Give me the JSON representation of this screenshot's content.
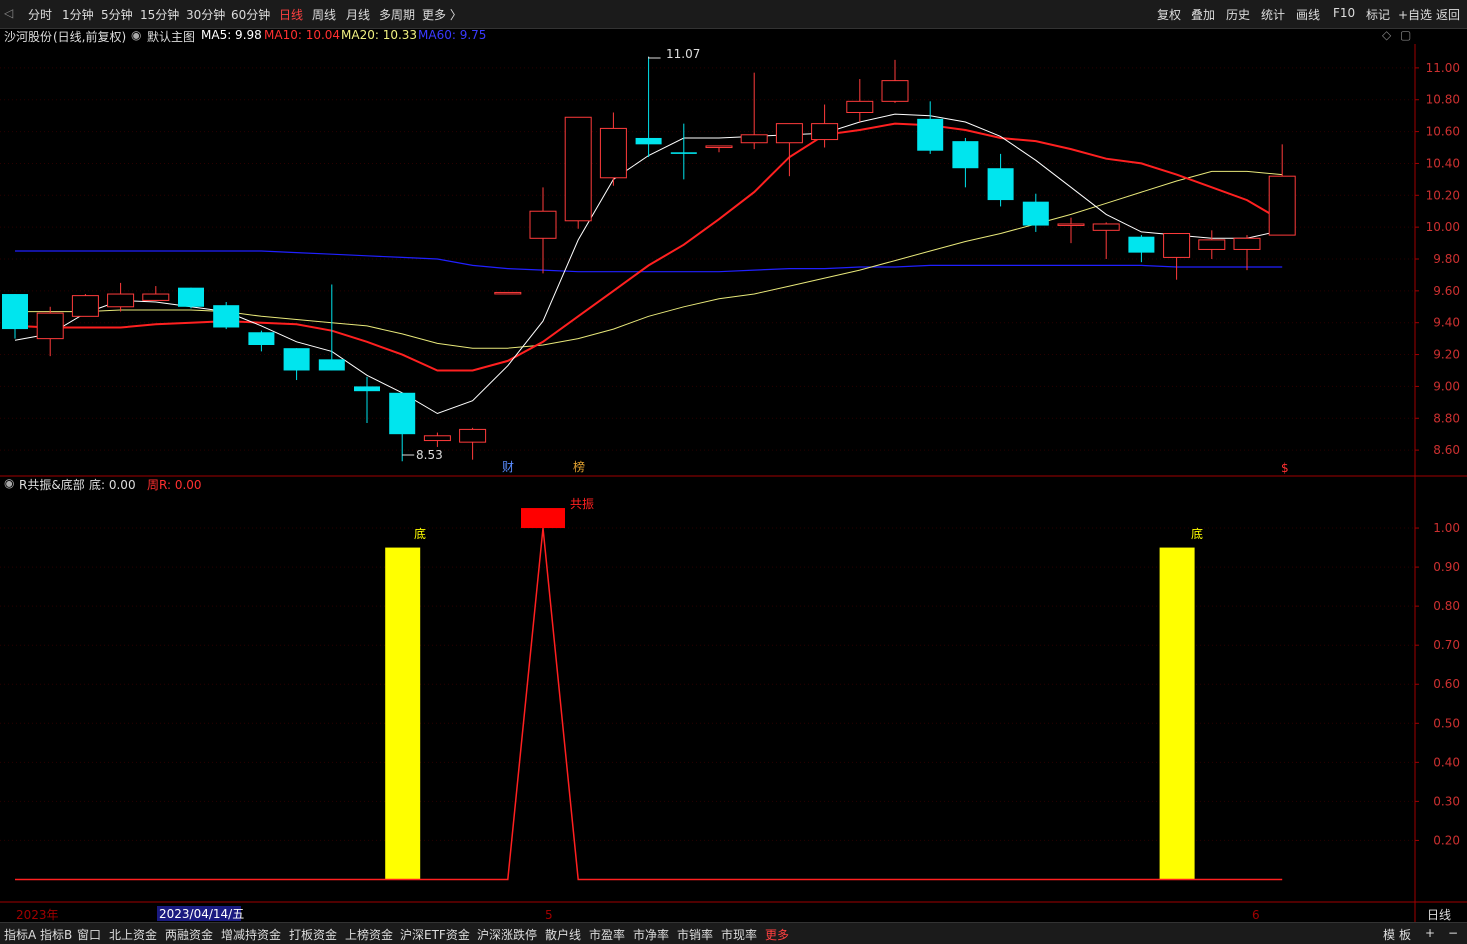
{
  "toolbar": {
    "periods": [
      "分时",
      "1分钟",
      "5分钟",
      "15分钟",
      "30分钟",
      "60分钟",
      "日线",
      "周线",
      "月线",
      "多周期",
      "更多 〉"
    ],
    "active_period": "日线",
    "right_buttons": [
      "复权",
      "叠加",
      "历史",
      "统计",
      "画线",
      "F10",
      "标记",
      "+自选",
      "返回"
    ]
  },
  "main_header": {
    "stock": "沙河股份",
    "mode": "(日线,前复权)",
    "template": "默认主图",
    "ma5": "MA5: 9.98",
    "ma10": "MA10: 10.04",
    "ma20": "MA20: 10.33",
    "ma60": "MA60: 9.75"
  },
  "indicator_header": {
    "name": "R共振&底部",
    "di": "底: 0.00",
    "zhou": "周R: 0.00"
  },
  "labels": {
    "high": "11.07",
    "low": "8.53",
    "cai": "财",
    "bang": "榜",
    "dollar": "$",
    "di1": "底",
    "di2": "底",
    "resonance": "共振"
  },
  "price_axis": [
    "11.00",
    "10.80",
    "10.60",
    "10.40",
    "10.20",
    "10.00",
    "9.80",
    "9.60",
    "9.40",
    "9.20",
    "9.00",
    "8.80",
    "8.60"
  ],
  "ind_axis": [
    "1.00",
    "0.90",
    "0.80",
    "0.70",
    "0.60",
    "0.50",
    "0.40",
    "0.30",
    "0.20"
  ],
  "date_axis": {
    "year": "2023年",
    "cursor_date": "2023/04/14/五",
    "m5": "5",
    "m6": "6",
    "period": "日线"
  },
  "bottombar": {
    "items": [
      "指标A",
      "指标B",
      "窗口",
      "北上资金",
      "两融资金",
      "增减持资金",
      "打板资金",
      "上榜资金",
      "沪深ETF资金",
      "沪深涨跌停",
      "散户线",
      "市盈率",
      "市净率",
      "市销率",
      "市现率",
      "更多"
    ],
    "right": [
      "模",
      "板",
      "+",
      "−"
    ]
  },
  "colors": {
    "up": "#ff3b3b",
    "down": "#00e5ee",
    "ma5": "#ffffff",
    "ma10": "#ff2020",
    "ma20": "#e8e87a",
    "ma60": "#2020ff",
    "axis": "#a00000"
  },
  "chart_data": {
    "type": "candlestick",
    "candles": [
      {
        "o": 9.58,
        "h": 9.58,
        "l": 9.3,
        "c": 9.36
      },
      {
        "o": 9.3,
        "h": 9.5,
        "l": 9.19,
        "c": 9.46
      },
      {
        "o": 9.44,
        "h": 9.58,
        "l": 9.44,
        "c": 9.57
      },
      {
        "o": 9.5,
        "h": 9.65,
        "l": 9.47,
        "c": 9.58
      },
      {
        "o": 9.54,
        "h": 9.63,
        "l": 9.54,
        "c": 9.58
      },
      {
        "o": 9.62,
        "h": 9.62,
        "l": 9.49,
        "c": 9.5
      },
      {
        "o": 9.51,
        "h": 9.53,
        "l": 9.36,
        "c": 9.37
      },
      {
        "o": 9.34,
        "h": 9.35,
        "l": 9.22,
        "c": 9.26
      },
      {
        "o": 9.24,
        "h": 9.24,
        "l": 9.04,
        "c": 9.1
      },
      {
        "o": 9.17,
        "h": 9.64,
        "l": 9.1,
        "c": 9.1
      },
      {
        "o": 9.0,
        "h": 9.06,
        "l": 8.77,
        "c": 8.97
      },
      {
        "o": 8.96,
        "h": 8.96,
        "l": 8.53,
        "c": 8.7
      },
      {
        "o": 8.66,
        "h": 8.71,
        "l": 8.62,
        "c": 8.69
      },
      {
        "o": 8.65,
        "h": 8.74,
        "l": 8.54,
        "c": 8.73
      },
      {
        "o": 9.59,
        "h": 9.59,
        "l": 9.59,
        "c": 9.59
      },
      {
        "o": 9.93,
        "h": 10.25,
        "l": 9.71,
        "c": 10.1
      },
      {
        "o": 10.04,
        "h": 10.44,
        "l": 9.99,
        "c": 10.69
      },
      {
        "o": 10.31,
        "h": 10.72,
        "l": 10.26,
        "c": 10.62
      },
      {
        "o": 10.56,
        "h": 11.07,
        "l": 10.44,
        "c": 10.52
      },
      {
        "o": 10.47,
        "h": 10.65,
        "l": 10.3,
        "c": 10.46
      },
      {
        "o": 10.5,
        "h": 10.51,
        "l": 10.47,
        "c": 10.51
      },
      {
        "o": 10.53,
        "h": 10.97,
        "l": 10.49,
        "c": 10.58
      },
      {
        "o": 10.53,
        "h": 10.65,
        "l": 10.32,
        "c": 10.65
      },
      {
        "o": 10.55,
        "h": 10.77,
        "l": 10.5,
        "c": 10.65
      },
      {
        "o": 10.72,
        "h": 10.93,
        "l": 10.66,
        "c": 10.79
      },
      {
        "o": 10.79,
        "h": 11.05,
        "l": 10.78,
        "c": 10.92
      },
      {
        "o": 10.68,
        "h": 10.79,
        "l": 10.46,
        "c": 10.48
      },
      {
        "o": 10.54,
        "h": 10.56,
        "l": 10.25,
        "c": 10.37
      },
      {
        "o": 10.37,
        "h": 10.46,
        "l": 10.13,
        "c": 10.17
      },
      {
        "o": 10.16,
        "h": 10.21,
        "l": 9.97,
        "c": 10.01
      },
      {
        "o": 10.02,
        "h": 10.06,
        "l": 9.9,
        "c": 10.02
      },
      {
        "o": 9.98,
        "h": 10.03,
        "l": 9.8,
        "c": 10.02
      },
      {
        "o": 9.94,
        "h": 9.95,
        "l": 9.78,
        "c": 9.84
      },
      {
        "o": 9.81,
        "h": 9.96,
        "l": 9.67,
        "c": 9.96
      },
      {
        "o": 9.86,
        "h": 9.98,
        "l": 9.8,
        "c": 9.92
      },
      {
        "o": 9.86,
        "h": 9.95,
        "l": 9.73,
        "c": 9.93
      },
      {
        "o": 9.95,
        "h": 10.52,
        "l": 9.95,
        "c": 10.32
      }
    ],
    "ma5": [
      9.29,
      9.33,
      9.46,
      9.54,
      9.53,
      9.5,
      9.47,
      9.38,
      9.28,
      9.22,
      9.07,
      8.96,
      8.83,
      8.91,
      9.13,
      9.41,
      9.92,
      10.3,
      10.45,
      10.56,
      10.56,
      10.57,
      10.58,
      10.59,
      10.66,
      10.71,
      10.7,
      10.66,
      10.57,
      10.42,
      10.25,
      10.08,
      9.97,
      9.95,
      9.93,
      9.93,
      9.98
    ],
    "ma10": [
      9.38,
      9.37,
      9.37,
      9.37,
      9.39,
      9.4,
      9.41,
      9.4,
      9.39,
      9.35,
      9.28,
      9.2,
      9.1,
      9.1,
      9.16,
      9.28,
      9.44,
      9.6,
      9.76,
      9.89,
      10.05,
      10.22,
      10.44,
      10.58,
      10.61,
      10.65,
      10.64,
      10.61,
      10.56,
      10.54,
      10.49,
      10.43,
      10.4,
      10.33,
      10.25,
      10.17,
      10.04
    ],
    "ma20": [
      9.47,
      9.47,
      9.47,
      9.48,
      9.48,
      9.48,
      9.47,
      9.44,
      9.42,
      9.4,
      9.38,
      9.33,
      9.27,
      9.24,
      9.24,
      9.26,
      9.3,
      9.36,
      9.44,
      9.5,
      9.55,
      9.58,
      9.63,
      9.68,
      9.73,
      9.79,
      9.85,
      9.91,
      9.96,
      10.02,
      10.08,
      10.15,
      10.22,
      10.29,
      10.35,
      10.35,
      10.33
    ],
    "ma60": [
      9.85,
      9.85,
      9.85,
      9.85,
      9.85,
      9.85,
      9.85,
      9.85,
      9.84,
      9.83,
      9.82,
      9.81,
      9.8,
      9.76,
      9.74,
      9.73,
      9.72,
      9.72,
      9.72,
      9.72,
      9.72,
      9.73,
      9.74,
      9.74,
      9.75,
      9.75,
      9.76,
      9.76,
      9.76,
      9.76,
      9.76,
      9.76,
      9.76,
      9.75,
      9.75,
      9.75,
      9.75
    ],
    "price_range": [
      8.45,
      11.15
    ],
    "indicator": {
      "di": [
        0,
        0,
        0,
        0,
        0,
        0,
        0,
        0,
        0,
        0,
        0,
        0.95,
        0,
        0,
        0,
        0,
        0,
        0,
        0,
        0,
        0,
        0,
        0,
        0,
        0,
        0,
        0,
        0,
        0,
        0,
        0,
        0,
        0,
        0.95,
        0,
        0,
        0
      ],
      "resonance": [
        0,
        0,
        0,
        0,
        0,
        0,
        0,
        0,
        0,
        0,
        0,
        0,
        0,
        0,
        0,
        1.0,
        0,
        0,
        0,
        0,
        0,
        0,
        0,
        0,
        0,
        0,
        0,
        0,
        0,
        0,
        0,
        0,
        0,
        0,
        0,
        0,
        0
      ],
      "range": [
        0.05,
        1.1
      ]
    }
  }
}
